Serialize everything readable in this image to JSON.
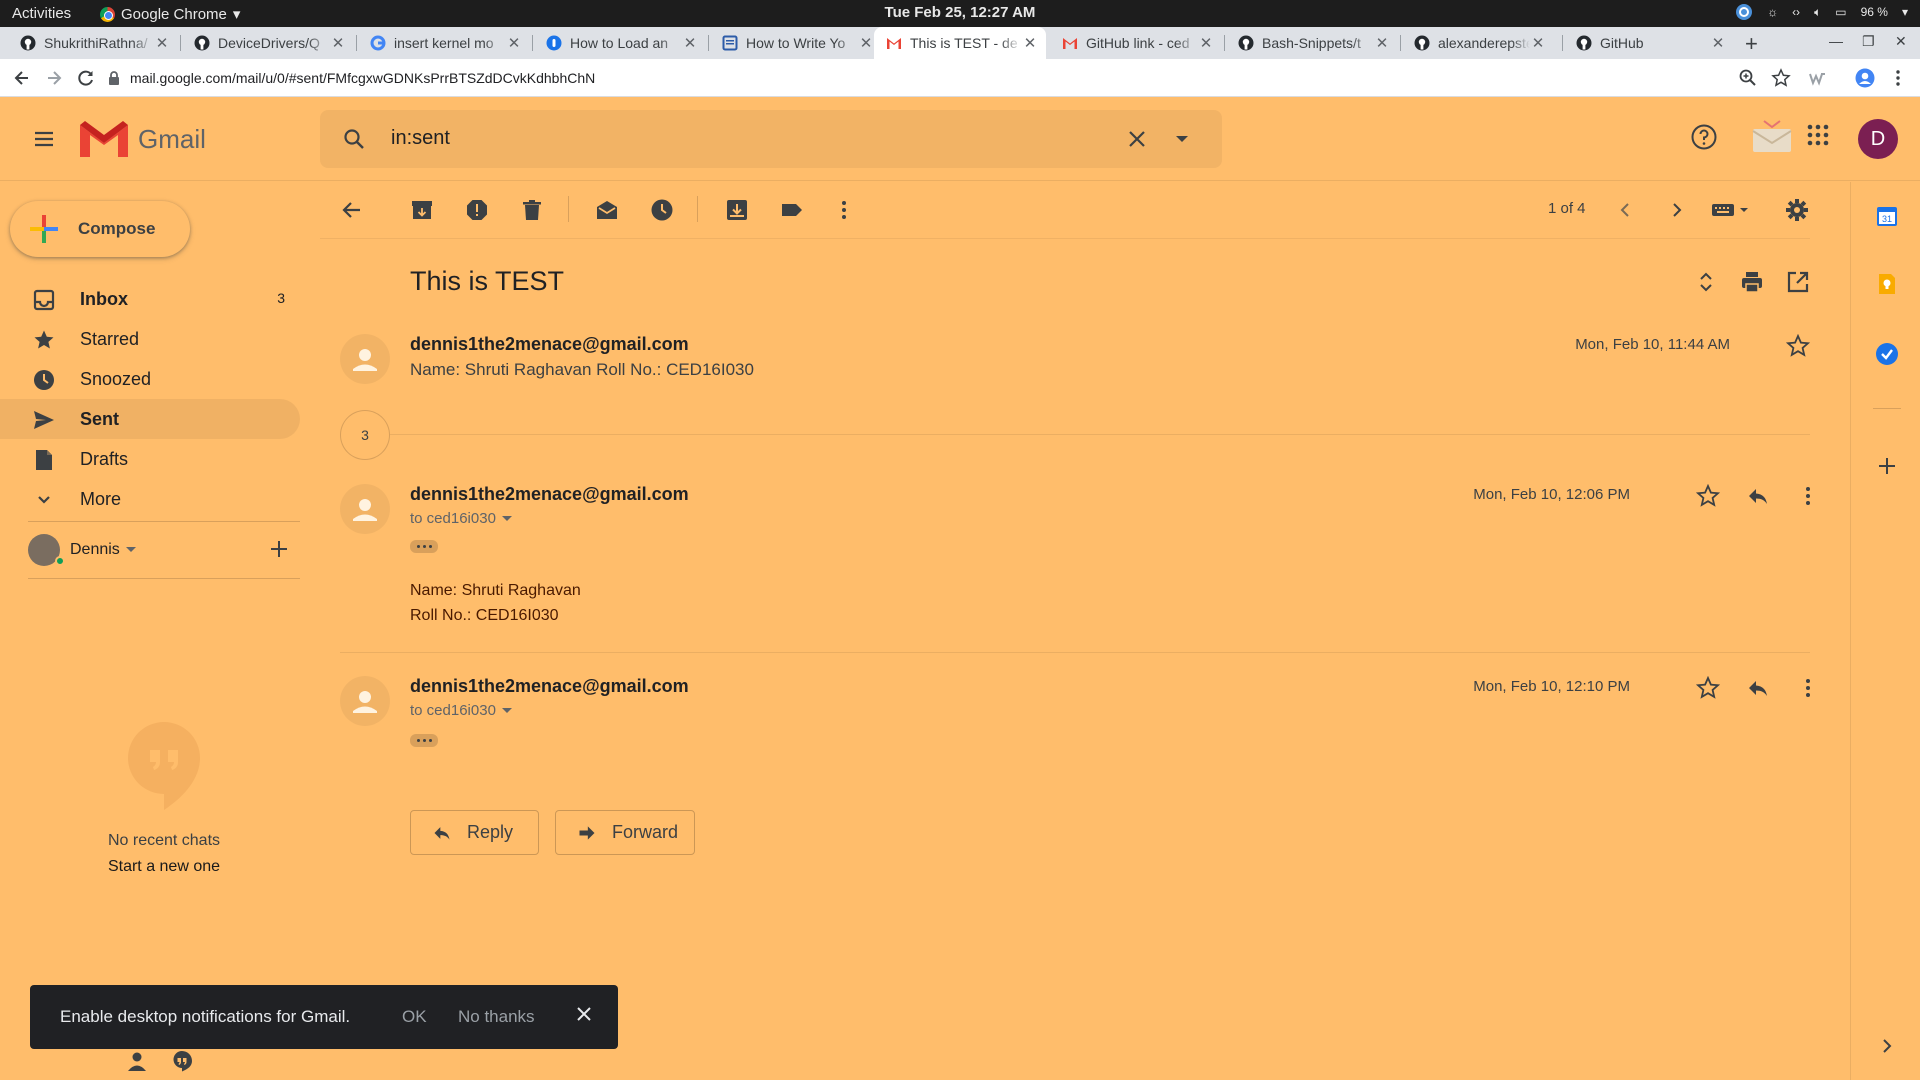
{
  "system": {
    "activities": "Activities",
    "app_name": "Google Chrome",
    "clock": "Tue Feb 25, 12:27 AM",
    "battery": "96 %"
  },
  "tabs": [
    {
      "title": "ShukrithiRathna/",
      "icon": "github-icon"
    },
    {
      "title": "DeviceDrivers/Q",
      "icon": "github-icon"
    },
    {
      "title": "insert kernel mo",
      "icon": "google-icon"
    },
    {
      "title": "How to Load an",
      "icon": "tab-site-icon"
    },
    {
      "title": "How to Write Yo",
      "icon": "doc-icon"
    },
    {
      "title": "This is TEST - de",
      "icon": "gmail-icon",
      "active": true
    },
    {
      "title": "GitHub link - ced",
      "icon": "gmail-icon"
    },
    {
      "title": "Bash-Snippets/t",
      "icon": "github-icon"
    },
    {
      "title": "alexanderepstei",
      "icon": "github-icon"
    },
    {
      "title": "GitHub",
      "icon": "github-icon"
    }
  ],
  "address": {
    "url": "mail.google.com/mail/u/0/#sent/FMfcgxwGDNKsPrrBTSZdDCvkKdhbhChN"
  },
  "gmail": {
    "logo_text": "Gmail",
    "search_value": "in:sent",
    "avatar_letter": "D",
    "compose_label": "Compose"
  },
  "nav": [
    {
      "label": "Inbox",
      "count": "3",
      "icon": "inbox-icon",
      "bold": true
    },
    {
      "label": "Starred",
      "count": "",
      "icon": "star-icon"
    },
    {
      "label": "Snoozed",
      "count": "",
      "icon": "clock-icon"
    },
    {
      "label": "Sent",
      "count": "",
      "icon": "send-icon",
      "active": true
    },
    {
      "label": "Drafts",
      "count": "",
      "icon": "draft-icon"
    },
    {
      "label": "More",
      "count": "",
      "icon": "chevron-down-icon"
    }
  ],
  "account": {
    "name": "Dennis"
  },
  "chats": {
    "empty_text": "No recent chats",
    "start_link": "Start a new one"
  },
  "toolbar": {
    "pager": "1 of 4"
  },
  "thread": {
    "subject": "This is TEST",
    "collapsed_count": "3",
    "messages": [
      {
        "from": "dennis1the2menace@gmail.com",
        "snippet": "Name: Shruti Raghavan Roll No.: CED16I030",
        "date": "Mon, Feb 10, 11:44 AM"
      },
      {
        "from": "dennis1the2menace@gmail.com",
        "to": "to ced16i030",
        "date": "Mon, Feb 10, 12:06 PM",
        "body_line1": "Name: Shruti Raghavan",
        "body_line2": "Roll No.: CED16I030"
      },
      {
        "from": "dennis1the2menace@gmail.com",
        "to": "to ced16i030",
        "date": "Mon, Feb 10, 12:10 PM"
      }
    ],
    "reply_label": "Reply",
    "forward_label": "Forward"
  },
  "snackbar": {
    "text": "Enable desktop notifications for Gmail.",
    "ok": "OK",
    "no_thanks": "No thanks"
  },
  "colors": {
    "theme_background": "#ffbd6b",
    "gmail_red": "#ea4335",
    "snackbar_bg": "#202124",
    "avatar_bg": "#7b1f52"
  }
}
